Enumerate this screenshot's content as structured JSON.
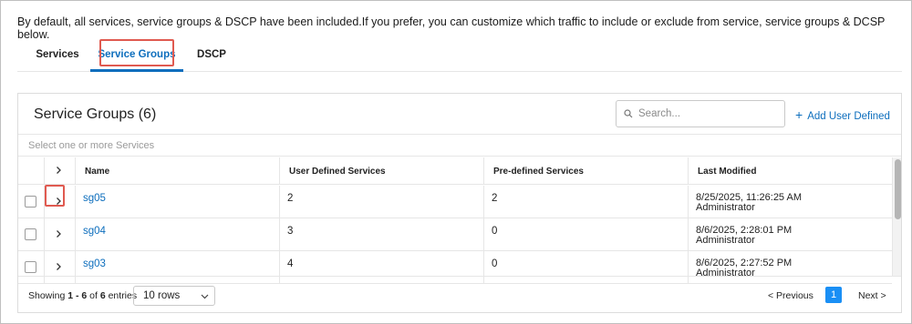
{
  "intro": "By default, all services, service groups & DSCP have been included.If you prefer, you can customize which traffic to include or exclude from service, service groups & DCSP below.",
  "tabs": [
    {
      "label": "Services"
    },
    {
      "label": "Service Groups"
    },
    {
      "label": "DSCP"
    }
  ],
  "panel": {
    "title": "Service Groups (6)",
    "search_placeholder": "Search...",
    "add_label": "Add User Defined",
    "filter_placeholder": "Select one or more Services"
  },
  "table": {
    "columns": [
      "Name",
      "User Defined Services",
      "Pre-defined Services",
      "Last Modified"
    ],
    "rows": [
      {
        "name": "sg05",
        "user_defined": "2",
        "predefined": "2",
        "modified": "8/25/2025, 11:26:25 AM",
        "by": "Administrator"
      },
      {
        "name": "sg04",
        "user_defined": "3",
        "predefined": "0",
        "modified": "8/6/2025, 2:28:01 PM",
        "by": "Administrator"
      },
      {
        "name": "sg03",
        "user_defined": "4",
        "predefined": "0",
        "modified": "8/6/2025, 2:27:52 PM",
        "by": "Administrator"
      }
    ]
  },
  "footer": {
    "showing_prefix": "Showing",
    "range": "1 - 6",
    "of": "of",
    "total": "6",
    "entries": "entries",
    "rows_per_page": "10 rows",
    "prev_label": "< Previous",
    "current_page": "1",
    "next_label": "Next >"
  },
  "colors": {
    "accent": "#0d6ebd",
    "page_active": "#1a8ff5",
    "highlight": "#e05a50"
  }
}
